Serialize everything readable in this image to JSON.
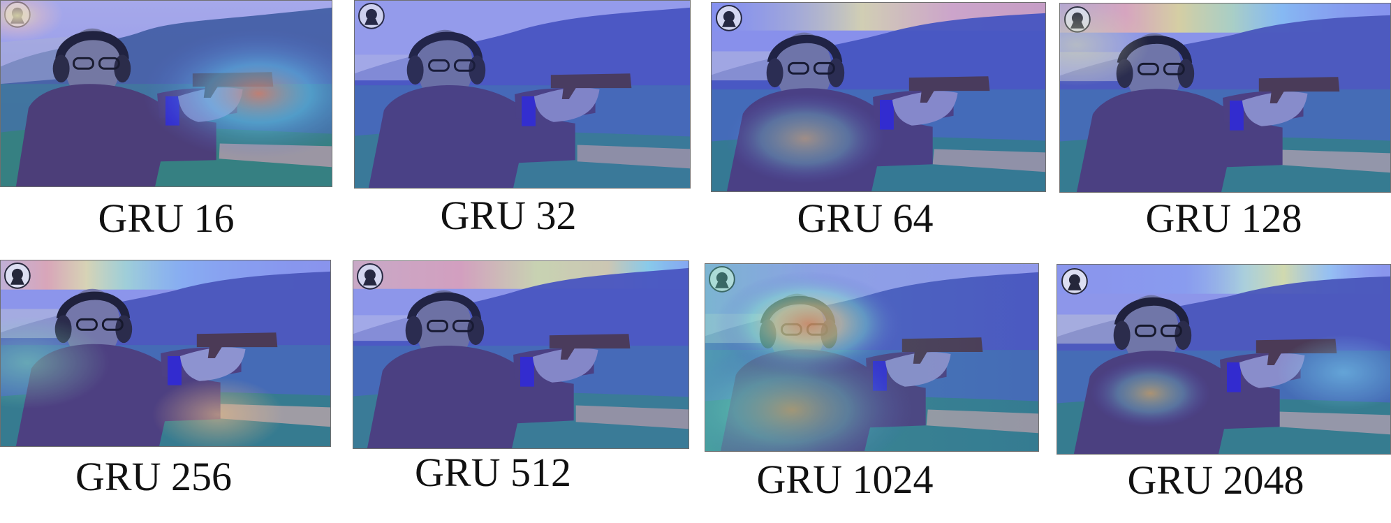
{
  "captions": [
    "GRU 16",
    "GRU 32",
    "GRU 64",
    "GRU 128",
    "GRU 256",
    "GRU 512",
    "GRU 1024",
    "GRU 2048"
  ],
  "heatmap": {
    "base_blue": "#5c63d0",
    "warm_colors": [
      "#ffb6b6",
      "#fff59a",
      "#9ff4ff",
      "#ff9b62"
    ],
    "hill_green": "#3f8f90",
    "grass_green": "#2d8f68",
    "sweater": "#4d3a66",
    "skin": "#7a7d96"
  },
  "icons": {
    "emblem": "portrait-seal-icon"
  }
}
